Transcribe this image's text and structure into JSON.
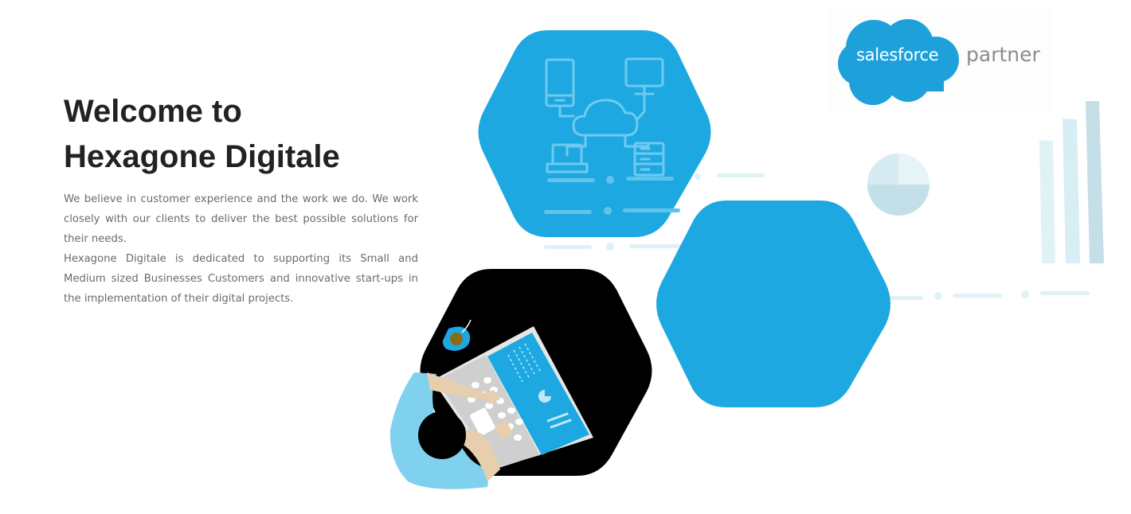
{
  "hero": {
    "title_line1": "Welcome to",
    "title_line2": "Hexagone Digitale",
    "paragraph1": "We believe in customer experience and the work we do. We work closely with our clients to deliver the best possible solutions for their needs.",
    "paragraph2": "Hexagone Digitale is dedicated to supporting its Small and Medium sized Businesses Customers and innovative start-ups in the implementation of their digital projects."
  },
  "badge": {
    "brand": "salesforce",
    "suffix": "partner"
  },
  "colors": {
    "primary_blue": "#1ea8e1",
    "heading": "#222222",
    "body_text": "#6b6b6b",
    "partner_gray": "#8a8d91",
    "light_blue": "#cfeaf3"
  },
  "icons": [
    "cloud-network-icon",
    "laptop-icon",
    "desktop-icon",
    "mobile-icon",
    "server-icon",
    "pie-chart-icon",
    "bar-chart-icon",
    "salesforce-cloud-icon"
  ]
}
